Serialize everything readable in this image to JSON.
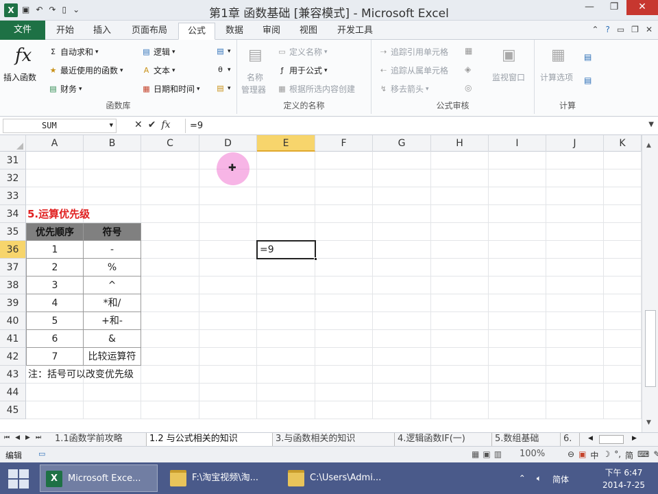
{
  "window": {
    "title": "第1章 函数基础  [兼容模式]  -  Microsoft Excel",
    "app_icon": "X",
    "qat": [
      "save-icon",
      "undo-icon",
      "redo-icon",
      "new-icon",
      "customize-icon"
    ]
  },
  "ribbon_tabs": [
    "文件",
    "开始",
    "插入",
    "页面布局",
    "公式",
    "数据",
    "审阅",
    "视图",
    "开发工具"
  ],
  "active_tab": "公式",
  "ribbon": {
    "function_library": {
      "label": "函数库",
      "insert_function": "插入函数",
      "autosum": "自动求和",
      "recent": "最近使用的函数",
      "financial": "财务",
      "logical": "逻辑",
      "text": "文本",
      "datetime": "日期和时间"
    },
    "defined_names": {
      "label": "定义的名称",
      "name_manager_1": "名称",
      "name_manager_2": "管理器",
      "define_name": "定义名称",
      "use_in_formula": "用于公式",
      "create_from_selection": "根据所选内容创建"
    },
    "formula_auditing": {
      "label": "公式审核",
      "trace_precedents": "追踪引用单元格",
      "trace_dependents": "追踪从属单元格",
      "remove_arrows": "移去箭头",
      "watch_window": "监视窗口"
    },
    "calculation": {
      "label": "计算",
      "options": "计算选项"
    }
  },
  "formula_bar": {
    "name_box": "SUM",
    "value": "=9",
    "cancel_icon": "✕",
    "enter_icon": "✔",
    "fx_icon": "fx"
  },
  "columns": [
    "A",
    "B",
    "C",
    "D",
    "E",
    "F",
    "G",
    "H",
    "I",
    "J",
    "K"
  ],
  "selected_column": "E",
  "rows": [
    "31",
    "32",
    "33",
    "34",
    "35",
    "36",
    "37",
    "38",
    "39",
    "40",
    "41",
    "42",
    "43",
    "44",
    "45"
  ],
  "selected_row": "36",
  "sheet": {
    "section_title": "5.运算优先级",
    "table_headers": [
      "优先顺序",
      "符号"
    ],
    "table_rows": [
      [
        "1",
        "-"
      ],
      [
        "2",
        "%"
      ],
      [
        "3",
        "^"
      ],
      [
        "4",
        "*和/"
      ],
      [
        "5",
        "+和-"
      ],
      [
        "6",
        "&"
      ],
      [
        "7",
        "比较运算符"
      ]
    ],
    "note": "注：括号可以改变优先级",
    "active_cell_value": "=9"
  },
  "sheet_tabs": [
    "1.1函数学前攻略",
    "1.2 与公式相关的知识",
    "3.与函数相关的知识",
    "4.逻辑函数IF(一)",
    "5.数组基础",
    "6."
  ],
  "active_sheet": "1.2 与公式相关的知识",
  "status": {
    "mode": "编辑",
    "zoom": "100%",
    "ime": [
      "中",
      "简"
    ]
  },
  "taskbar": {
    "items": [
      "Microsoft Exce...",
      "F:\\淘宝视频\\淘...",
      "C:\\Users\\Admi..."
    ],
    "lang": "简体",
    "time": "下午 6:47",
    "date": "2014-7-25"
  }
}
